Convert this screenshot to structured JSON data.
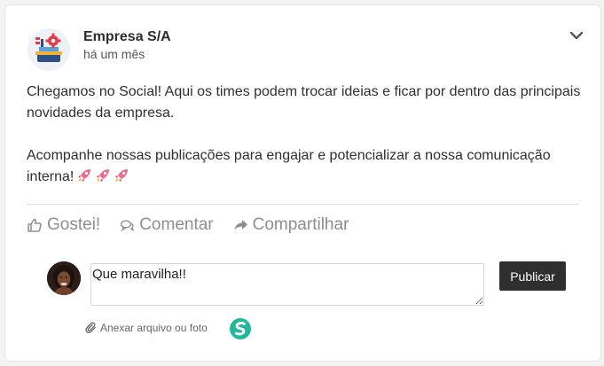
{
  "post": {
    "author": "Empresa S/A",
    "time": "há um mês",
    "body_paragraph_1": "Chegamos no Social! Aqui os times podem trocar ideias e ficar por dentro das principais novidades da empresa.",
    "body_paragraph_2": "Acompanhe nossas publicações para engajar e potencializar a nossa comunicação interna!",
    "emoji_icons": [
      "rocket-icon",
      "rocket-icon",
      "rocket-icon"
    ]
  },
  "actions": {
    "like_label": "Gostei!",
    "comment_label": "Comentar",
    "share_label": "Compartilhar"
  },
  "comment": {
    "value": "Que maravilha!!",
    "publish_label": "Publicar",
    "attach_label": "Anexar arquivo ou foto"
  },
  "icons": {
    "menu": "chevron-down-icon",
    "like": "thumbs-up-icon",
    "comment": "comment-bubble-icon",
    "share": "share-arrow-icon",
    "attach": "paperclip-icon",
    "app": "app-logo-icon"
  },
  "colors": {
    "text": "#2f2f2f",
    "action_gray": "#8e8e8e",
    "button_bg": "#2f2f2f",
    "app_logo": "#1fb89a"
  }
}
